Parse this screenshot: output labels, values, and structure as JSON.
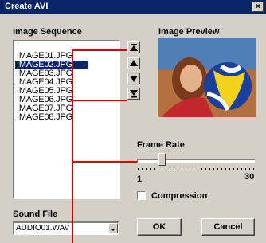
{
  "window": {
    "title": "Create AVI",
    "close_glyph": "×"
  },
  "image_sequence": {
    "label": "Image Sequence",
    "items": [
      "IMAGE01.JPG",
      "IMAGE02.JPG",
      "IMAGE03.JPG",
      "IMAGE04.JPG",
      "IMAGE05.JPG",
      "IMAGE06.JPG",
      "IMAGE07.JPG",
      "IMAGE08.JPG"
    ],
    "selected": "IMAGE02.JPG"
  },
  "preview": {
    "label": "Image Preview"
  },
  "frame_rate": {
    "label": "Frame Rate",
    "min": "1",
    "max": "30",
    "value_fraction": 0.21
  },
  "compression": {
    "label": "Compression",
    "checked": false
  },
  "sound_file": {
    "label": "Sound File",
    "value": "AUDIO01.WAV"
  },
  "buttons": {
    "ok": "OK",
    "cancel": "Cancel"
  },
  "colors": {
    "titlebar": "#0a246a",
    "selection": "#0a246a",
    "callout_line": "#e10000"
  }
}
